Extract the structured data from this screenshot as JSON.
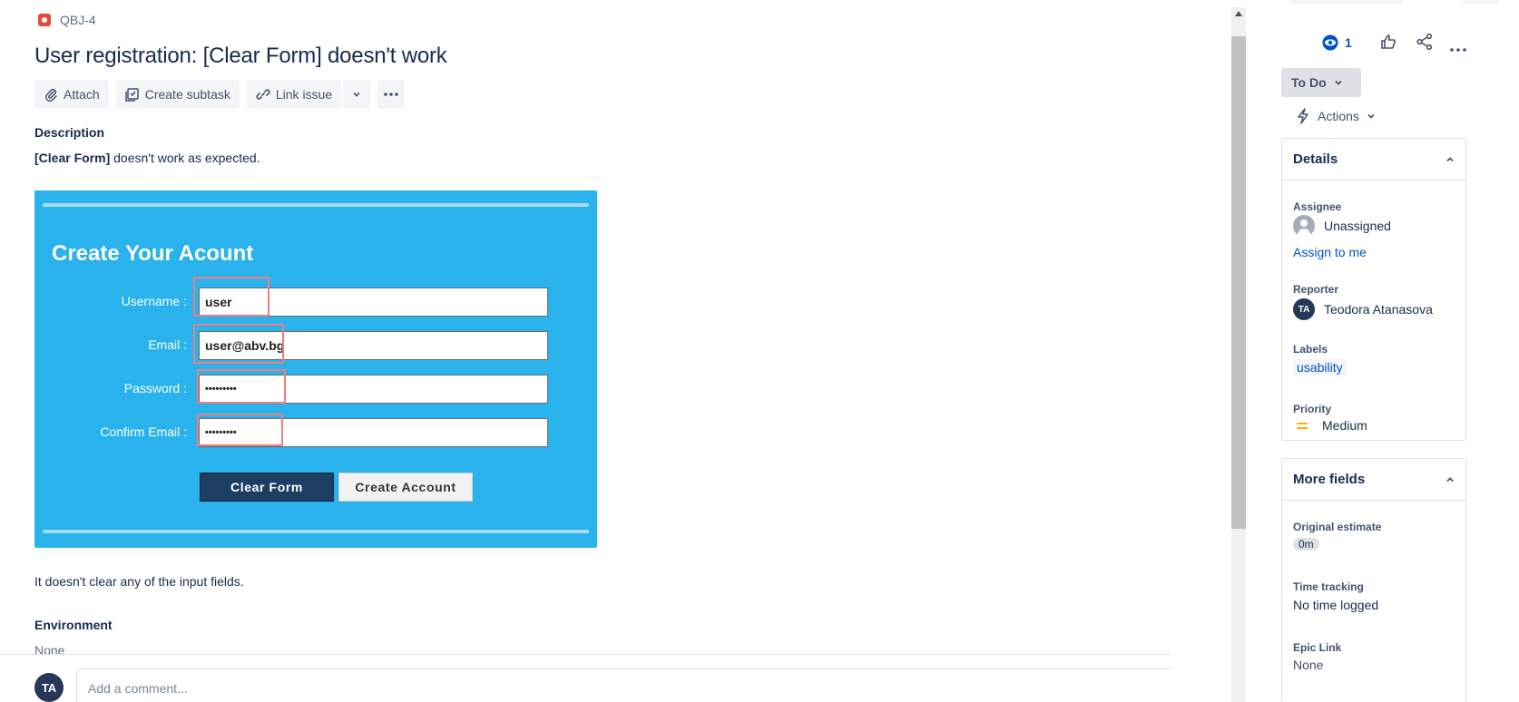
{
  "issue": {
    "key": "QBJ-4",
    "summary": "User registration: [Clear Form] doesn't work"
  },
  "toolbar": {
    "attach": "Attach",
    "create_subtask": "Create subtask",
    "link_issue": "Link issue"
  },
  "description": {
    "label": "Description",
    "bold": "[Clear Form]",
    "text": " doesn't work as expected.",
    "after": "It doesn't clear any of the input fields."
  },
  "embedded_form": {
    "title": "Create Your Acount",
    "fields": [
      {
        "label": "Username :",
        "value": "user"
      },
      {
        "label": "Email :",
        "value": "user@abv.bg"
      },
      {
        "label": "Password :",
        "value": "•••••••••"
      },
      {
        "label": "Confirm Email :",
        "value": "•••••••••"
      }
    ],
    "clear_button": "Clear Form",
    "create_button": "Create Account"
  },
  "environment": {
    "label": "Environment",
    "value": "None"
  },
  "comment": {
    "avatar": "TA",
    "placeholder": "Add a comment..."
  },
  "sidebar": {
    "watchers": "1",
    "status": "To Do",
    "actions": "Actions",
    "details": {
      "title": "Details",
      "assignee_label": "Assignee",
      "assignee_value": "Unassigned",
      "assign_to_me": "Assign to me",
      "reporter_label": "Reporter",
      "reporter_initials": "TA",
      "reporter_name": "Teodora Atanasova",
      "labels_label": "Labels",
      "labels_value": "usability",
      "priority_label": "Priority",
      "priority_value": "Medium"
    },
    "more_fields": {
      "title": "More fields",
      "original_estimate_label": "Original estimate",
      "original_estimate_value": "0m",
      "time_tracking_label": "Time tracking",
      "time_tracking_value": "No time logged",
      "epic_link_label": "Epic Link",
      "epic_link_value": "None"
    }
  },
  "colors": {
    "brand_blue": "#0052cc",
    "bug_red": "#e5493a",
    "embed_bg": "#29b2ec",
    "priority_medium": "#ffab00"
  }
}
